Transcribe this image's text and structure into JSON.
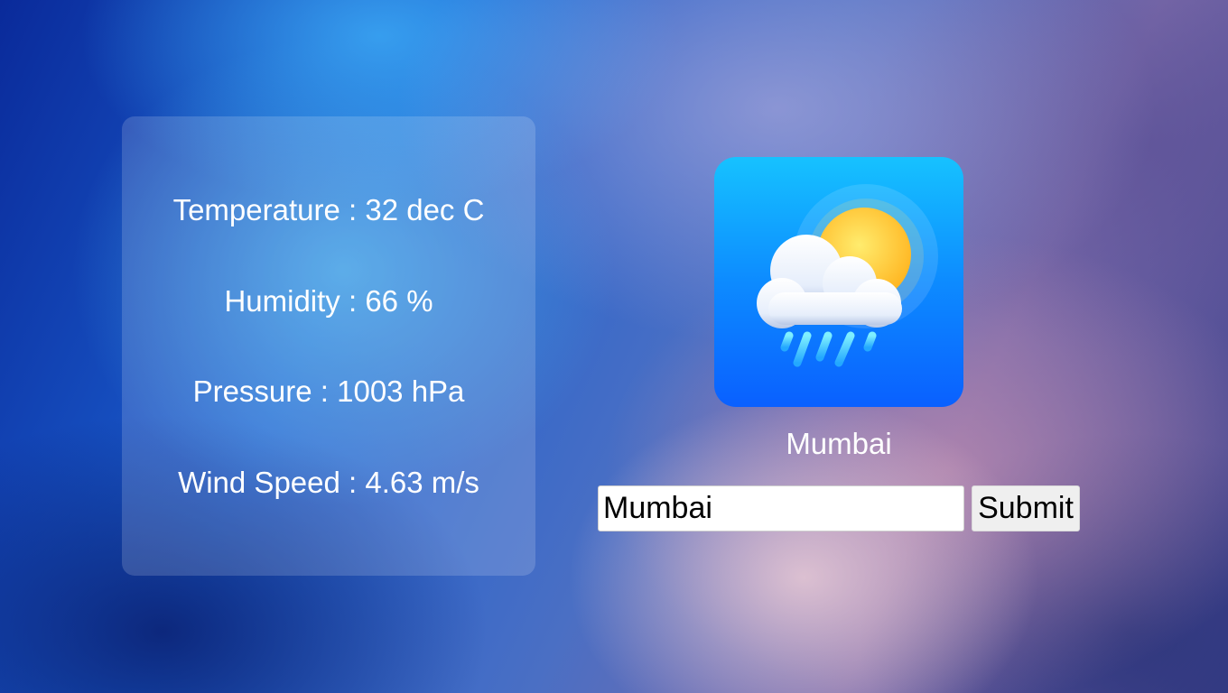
{
  "weather": {
    "temperature": "Temperature : 32 dec C",
    "humidity": "Humidity : 66 %",
    "pressure": "Pressure : 1003 hPa",
    "wind_speed": "Wind Speed : 4.63 m/s"
  },
  "location": {
    "city": "Mumbai",
    "icon": "rain-cloud-sun-icon"
  },
  "search": {
    "value": "Mumbai",
    "submit_label": "Submit"
  },
  "colors": {
    "icon_gradient_top": "#16c2ff",
    "icon_gradient_bottom": "#0a60ff",
    "sun": "#ffd23a",
    "rain": "#4fd3ff"
  }
}
